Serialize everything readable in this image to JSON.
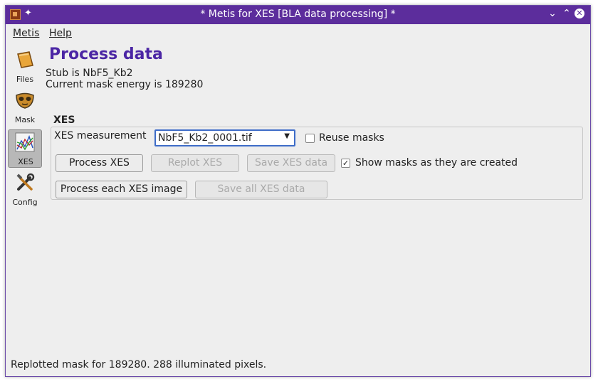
{
  "window": {
    "title": "* Metis for XES [BLA data processing] *"
  },
  "titlebar_buttons": {
    "minimize": "⌄",
    "maximize": "⌃",
    "close": "✕"
  },
  "menu": [
    {
      "label": "Metis"
    },
    {
      "label": "Help"
    }
  ],
  "sidebar": {
    "items": [
      {
        "label": "Files",
        "icon": "folder-icon"
      },
      {
        "label": "Mask",
        "icon": "mask-icon"
      },
      {
        "label": "XES",
        "icon": "chart-icon",
        "selected": true
      },
      {
        "label": "Config",
        "icon": "tools-icon"
      }
    ]
  },
  "page": {
    "heading": "Process data",
    "stub_text": "Stub is NbF5_Kb2",
    "mask_energy_text": "Current mask energy is 189280"
  },
  "xes_group": {
    "title": "XES",
    "measurement_label": "XES measurement",
    "measurement_value": "NbF5_Kb2_0001.tif",
    "reuse_masks_label": "Reuse masks",
    "reuse_masks_checked": false,
    "process_xes_label": "Process XES",
    "replot_xes_label": "Replot XES",
    "save_xes_label": "Save XES data",
    "show_masks_label": "Show masks as they are created",
    "show_masks_checked": true,
    "process_each_label": "Process each XES image",
    "save_all_label": "Save all XES data"
  },
  "status_bar": {
    "text": "Replotted mask for 189280.  288 illuminated pixels."
  },
  "colors": {
    "titlebar": "#5c2d9c",
    "heading": "#4b26a4",
    "focus": "#3d6cc8"
  }
}
